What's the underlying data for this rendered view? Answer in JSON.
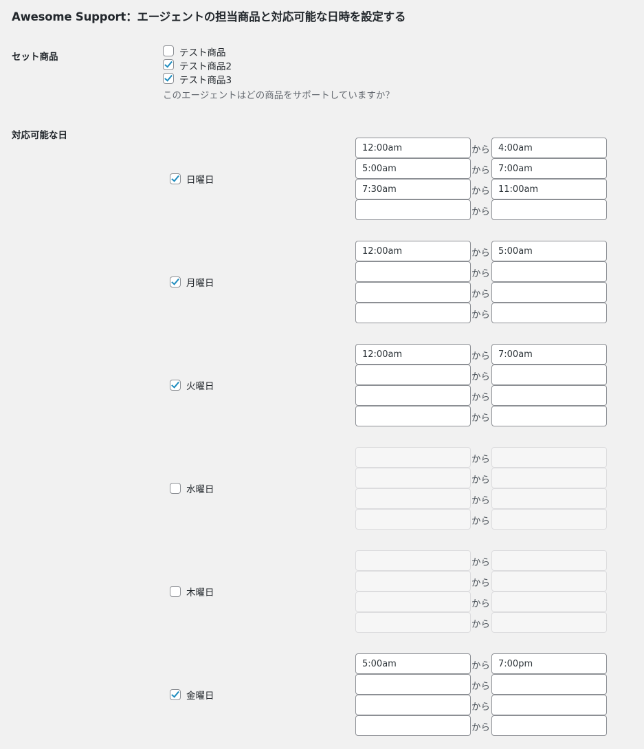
{
  "page": {
    "title": "Awesome Support：エージェントの担当商品と対応可能な日時を設定する"
  },
  "products": {
    "label": "セット商品",
    "description": "このエージェントはどの商品をサポートしていますか？",
    "items": [
      {
        "label": "テスト商品",
        "checked": false
      },
      {
        "label": "テスト商品2",
        "checked": true
      },
      {
        "label": "テスト商品3",
        "checked": true
      }
    ]
  },
  "availability": {
    "label": "対応可能な日",
    "separator": "から",
    "days": [
      {
        "label": "日曜日",
        "checked": true,
        "slots": [
          {
            "from": "12:00am",
            "to": "4:00am"
          },
          {
            "from": "5:00am",
            "to": "7:00am"
          },
          {
            "from": "7:30am",
            "to": "11:00am"
          },
          {
            "from": "",
            "to": ""
          }
        ]
      },
      {
        "label": "月曜日",
        "checked": true,
        "slots": [
          {
            "from": "12:00am",
            "to": "5:00am"
          },
          {
            "from": "",
            "to": ""
          },
          {
            "from": "",
            "to": ""
          },
          {
            "from": "",
            "to": ""
          }
        ]
      },
      {
        "label": "火曜日",
        "checked": true,
        "slots": [
          {
            "from": "12:00am",
            "to": "7:00am"
          },
          {
            "from": "",
            "to": ""
          },
          {
            "from": "",
            "to": ""
          },
          {
            "from": "",
            "to": ""
          }
        ]
      },
      {
        "label": "水曜日",
        "checked": false,
        "slots": [
          {
            "from": "",
            "to": ""
          },
          {
            "from": "",
            "to": ""
          },
          {
            "from": "",
            "to": ""
          },
          {
            "from": "",
            "to": ""
          }
        ]
      },
      {
        "label": "木曜日",
        "checked": false,
        "slots": [
          {
            "from": "",
            "to": ""
          },
          {
            "from": "",
            "to": ""
          },
          {
            "from": "",
            "to": ""
          },
          {
            "from": "",
            "to": ""
          }
        ]
      },
      {
        "label": "金曜日",
        "checked": true,
        "slots": [
          {
            "from": "5:00am",
            "to": "7:00pm"
          },
          {
            "from": "",
            "to": ""
          },
          {
            "from": "",
            "to": ""
          },
          {
            "from": "",
            "to": ""
          }
        ]
      }
    ]
  }
}
